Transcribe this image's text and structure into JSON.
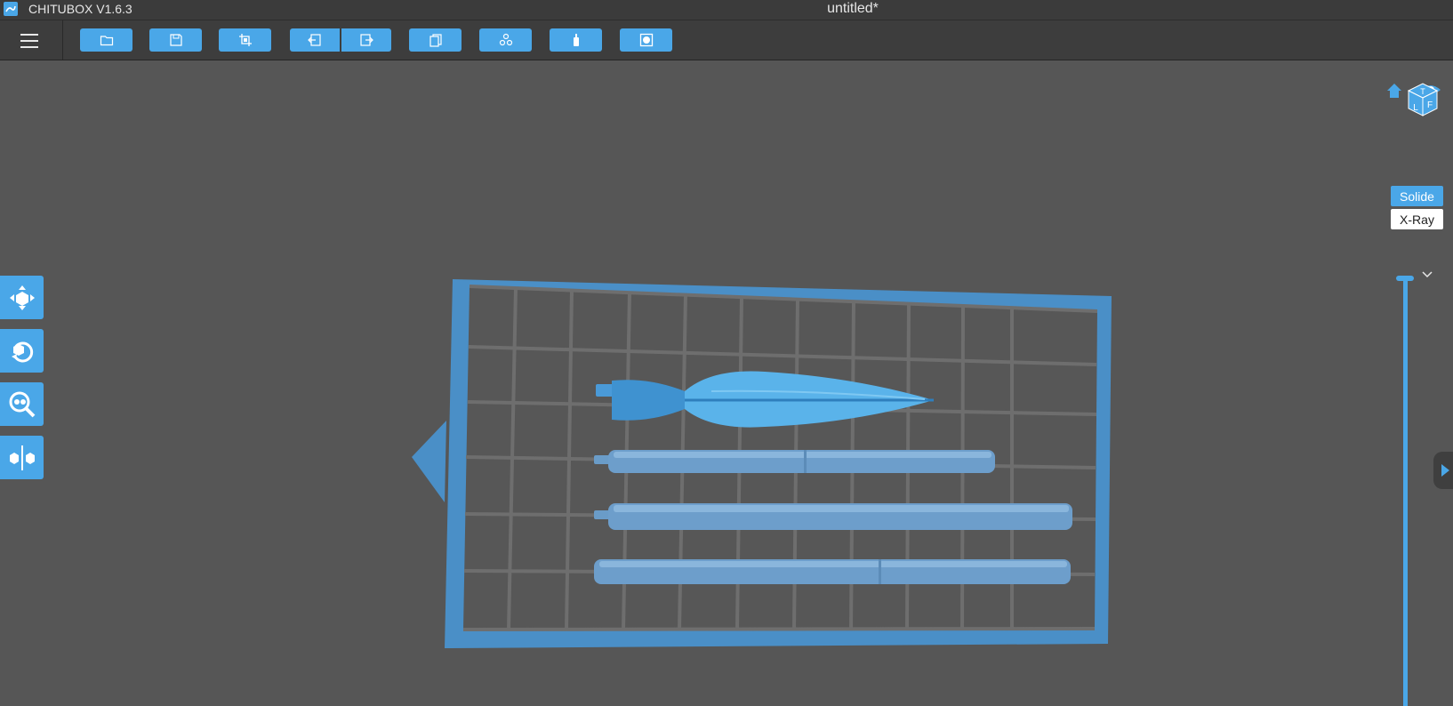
{
  "app": {
    "title": "CHITUBOX V1.6.3",
    "document": "untitled*",
    "accent": "#4aa7e8"
  },
  "toolbar": {
    "menu_icon": "hamburger-icon",
    "buttons": [
      {
        "name": "open-file",
        "icon": "folder-icon"
      },
      {
        "name": "save",
        "icon": "floppy-icon"
      },
      {
        "name": "crop",
        "icon": "crop-icon"
      },
      {
        "name": "undo",
        "icon": "undo-icon"
      },
      {
        "name": "redo",
        "icon": "redo-icon"
      },
      {
        "name": "copy",
        "icon": "copy-icon"
      },
      {
        "name": "auto-layout",
        "icon": "layout-icon"
      },
      {
        "name": "supports",
        "icon": "support-icon"
      },
      {
        "name": "slice",
        "icon": "slice-icon"
      }
    ]
  },
  "left_tools": [
    {
      "name": "move",
      "icon": "move-icon"
    },
    {
      "name": "rotate",
      "icon": "rotate-icon"
    },
    {
      "name": "scale",
      "icon": "scale-icon"
    },
    {
      "name": "mirror",
      "icon": "mirror-icon"
    }
  ],
  "viewcube": {
    "faces": [
      "T",
      "L",
      "F"
    ],
    "home_icon": "home-icon",
    "eye_icon": "eye-icon"
  },
  "render_mode": {
    "solide": "Solide",
    "xray": "X-Ray",
    "selected": "Solide"
  },
  "scene": {
    "plate_color": "#4a8fc7",
    "model_color": "#5aaee6",
    "models": [
      "arrowhead",
      "shaft-1",
      "shaft-2",
      "shaft-3"
    ]
  }
}
